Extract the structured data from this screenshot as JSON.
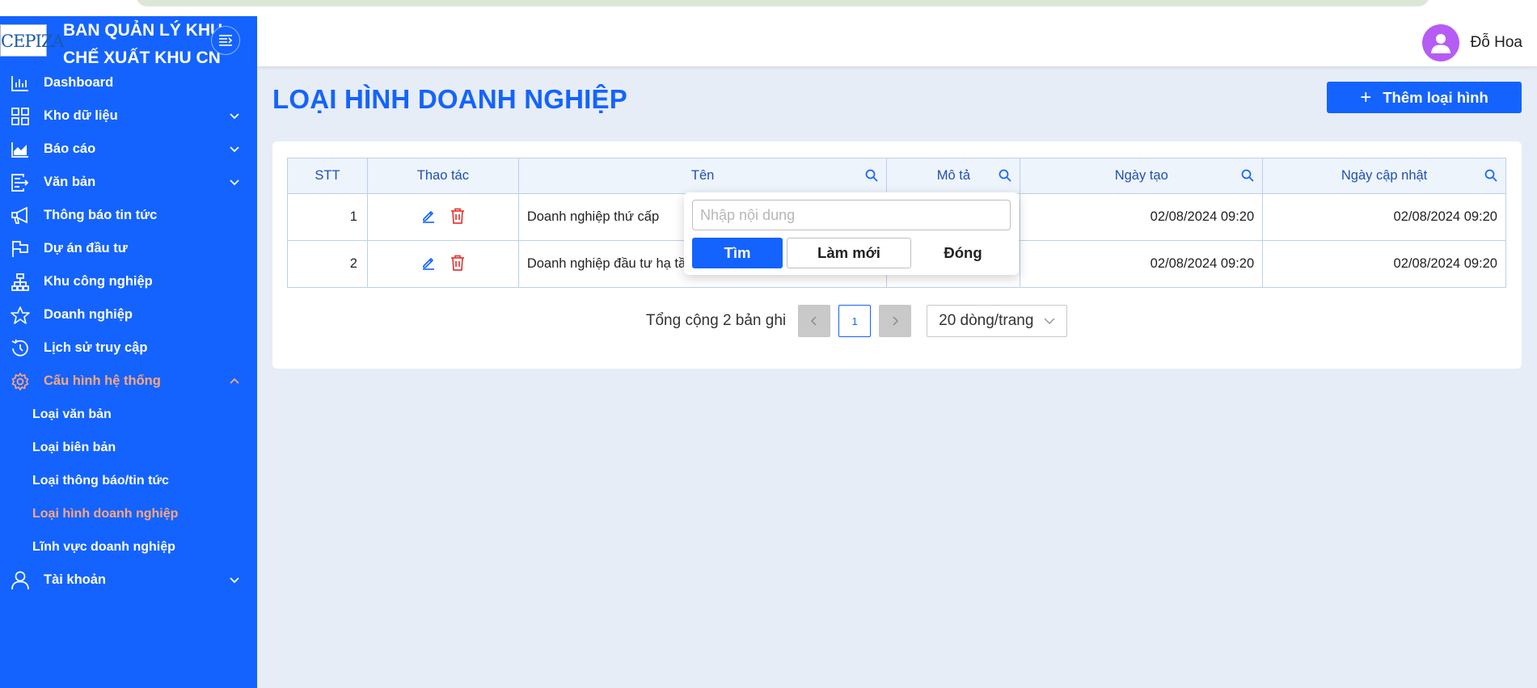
{
  "sidebar": {
    "logo_text": "CEPIZA",
    "title": "BAN QUẢN LÝ KHU CHẾ XUẤT KHU CN",
    "items": [
      {
        "label": "Dashboard",
        "icon": "bar-chart-icon"
      },
      {
        "label": "Kho dữ liệu",
        "icon": "grid-icon"
      },
      {
        "label": "Báo cáo",
        "icon": "area-chart-icon"
      },
      {
        "label": "Văn bản",
        "icon": "document-icon"
      },
      {
        "label": "Thông báo tin tức",
        "icon": "megaphone-icon"
      },
      {
        "label": "Dự án đầu tư",
        "icon": "flag-icon"
      },
      {
        "label": "Khu công nghiệp",
        "icon": "hierarchy-icon"
      },
      {
        "label": "Doanh nghiệp",
        "icon": "star-icon"
      },
      {
        "label": "Lịch sử truy cập",
        "icon": "clock-icon"
      },
      {
        "label": "Cấu hình hệ thống",
        "icon": "gear-icon"
      }
    ],
    "sub_items": [
      {
        "label": "Loại văn bản"
      },
      {
        "label": "Loại biên bản"
      },
      {
        "label": "Loại thông báo/tin tức"
      },
      {
        "label": "Loại hình doanh nghiệp"
      },
      {
        "label": "Lĩnh vực doanh nghiệp"
      }
    ],
    "account": {
      "label": "Tài khoản",
      "icon": "user-icon"
    },
    "active_color": "#ffa77a",
    "bg_color": "#1463ff"
  },
  "header": {
    "user_name": "Đỗ Hoa"
  },
  "main": {
    "title": "LOẠI HÌNH DOANH NGHIỆP",
    "add_button_label": "Thêm loại hình",
    "table": {
      "columns": {
        "stt": "STT",
        "actions": "Thao tác",
        "name": "Tên",
        "description": "Mô tả",
        "created": "Ngày tạo",
        "updated": "Ngày cập nhật"
      },
      "rows": [
        {
          "stt": "1",
          "name": "Doanh nghiệp thứ cấp",
          "description": "",
          "created": "02/08/2024 09:20",
          "updated": "02/08/2024 09:20"
        },
        {
          "stt": "2",
          "name": "Doanh nghiệp đầu tư hạ tầ",
          "description": "",
          "created": "02/08/2024 09:20",
          "updated": "02/08/2024 09:20"
        }
      ]
    },
    "pagination": {
      "total_text": "Tổng cộng 2 bản ghi",
      "current_page": "1",
      "page_size": "20 dòng/trang"
    },
    "filter_popup": {
      "placeholder": "Nhập nội dung",
      "find_label": "Tìm",
      "reset_label": "Làm mới",
      "close_label": "Đóng"
    }
  }
}
